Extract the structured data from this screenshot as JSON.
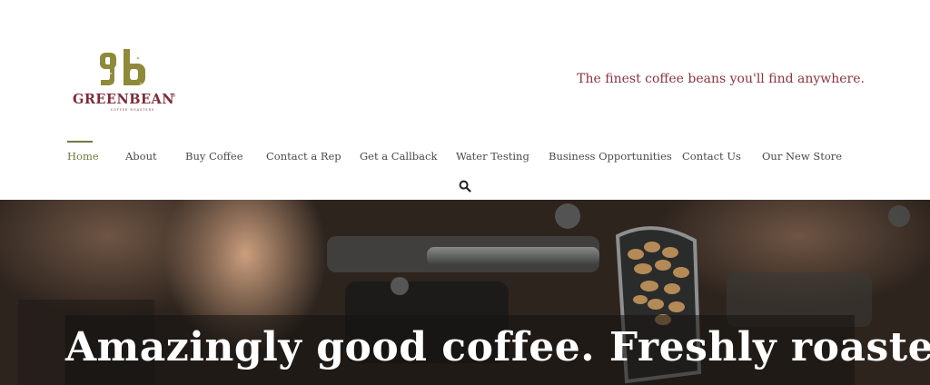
{
  "brand": {
    "logo_monogram": "gb",
    "logo_name": "GREENBEAN",
    "logo_trademark": "®",
    "logo_subtitle": "COFFEE ROASTERS",
    "tagline": "The finest coffee beans you'll find anywhere.",
    "colors": {
      "maroon": "#7d2b3a",
      "olive": "#8f8a3a",
      "nav_active": "#6f7a3e"
    }
  },
  "nav": {
    "items": [
      {
        "label": "Home",
        "active": true
      },
      {
        "label": "About",
        "active": false
      },
      {
        "label": "Buy Coffee",
        "active": false
      },
      {
        "label": "Contact a Rep",
        "active": false
      },
      {
        "label": "Get a Callback",
        "active": false
      },
      {
        "label": "Water Testing",
        "active": false
      },
      {
        "label": "Business Opportunities",
        "active": false
      },
      {
        "label": "Contact Us",
        "active": false
      },
      {
        "label": "Our New Store",
        "active": false
      }
    ],
    "search_icon": "search-icon"
  },
  "hero": {
    "headline": "Amazingly good coffee. Freshly roasted."
  }
}
